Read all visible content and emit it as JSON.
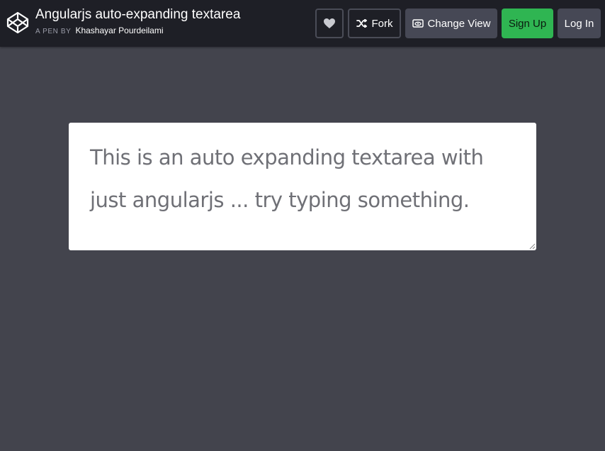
{
  "header": {
    "title": "Angularjs auto-expanding textarea",
    "byline_prefix": "A PEN BY",
    "author": "Khashayar Pourdeilami"
  },
  "buttons": {
    "fork_label": "Fork",
    "change_view_label": "Change View",
    "signup_label": "Sign Up",
    "login_label": "Log In"
  },
  "icons": {
    "logo": "codepen-logo-icon",
    "heart": "heart-icon",
    "fork": "fork-icon",
    "view": "change-view-icon"
  },
  "textarea": {
    "value": "This is an auto expanding textarea with just angularjs ... try typing something."
  },
  "colors": {
    "page_background": "#43444d",
    "header_background": "#1e1f26",
    "signup_green": "#2fb552",
    "button_gray": "#464855"
  }
}
